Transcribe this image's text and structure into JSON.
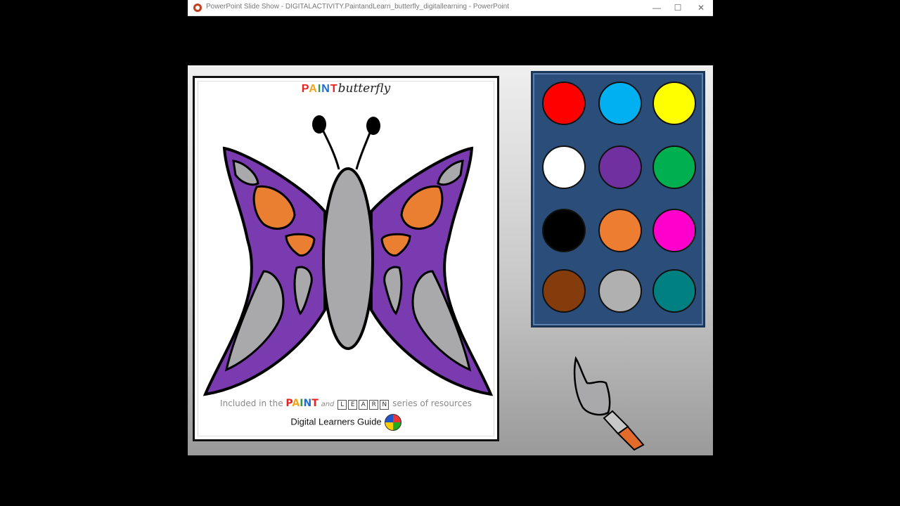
{
  "window": {
    "title": "PowerPoint Slide Show  -  DIGITALACTIVITY.PaintandLearn_butterfly_digitallearning - PowerPoint",
    "minimize": "—",
    "maximize": "☐",
    "close": "✕"
  },
  "sheet": {
    "title_paint_letters": [
      "P",
      "A",
      "I",
      "N",
      "T"
    ],
    "title_paint_colors": [
      "#e8231f",
      "#f7a21b",
      "#2b9c36",
      "#1e6cd3",
      "#e8231f"
    ],
    "title_butterfly": "butterfly",
    "included_prefix": "Included in the",
    "included_paint": "PAINT",
    "included_and": "and",
    "included_learn_letters": [
      "L",
      "E",
      "A",
      "R",
      "N"
    ],
    "included_suffix": "series of resources",
    "brand": "Digital Learners Guide"
  },
  "butterfly_colors": {
    "outline": "#000000",
    "wings": "#7a3ab0",
    "body": "#a9a9ab",
    "spots_orange": "#ea7f32",
    "spots_gray": "#a9a9ab"
  },
  "palette": {
    "colors": [
      {
        "name": "red",
        "hex": "#ff0000"
      },
      {
        "name": "sky-blue",
        "hex": "#00b0f0"
      },
      {
        "name": "yellow",
        "hex": "#ffff00"
      },
      {
        "name": "white",
        "hex": "#ffffff"
      },
      {
        "name": "purple",
        "hex": "#7030a0"
      },
      {
        "name": "green",
        "hex": "#00b050"
      },
      {
        "name": "black",
        "hex": "#000000"
      },
      {
        "name": "orange",
        "hex": "#ed7d31"
      },
      {
        "name": "magenta",
        "hex": "#ff00cc"
      },
      {
        "name": "brown",
        "hex": "#843c0c"
      },
      {
        "name": "gray",
        "hex": "#b0b0b0"
      },
      {
        "name": "teal",
        "hex": "#008080"
      }
    ]
  },
  "brush": {
    "tip": "#a9a9ab",
    "ferrule": "#c8c8c8",
    "handle": "#e26b2c"
  }
}
